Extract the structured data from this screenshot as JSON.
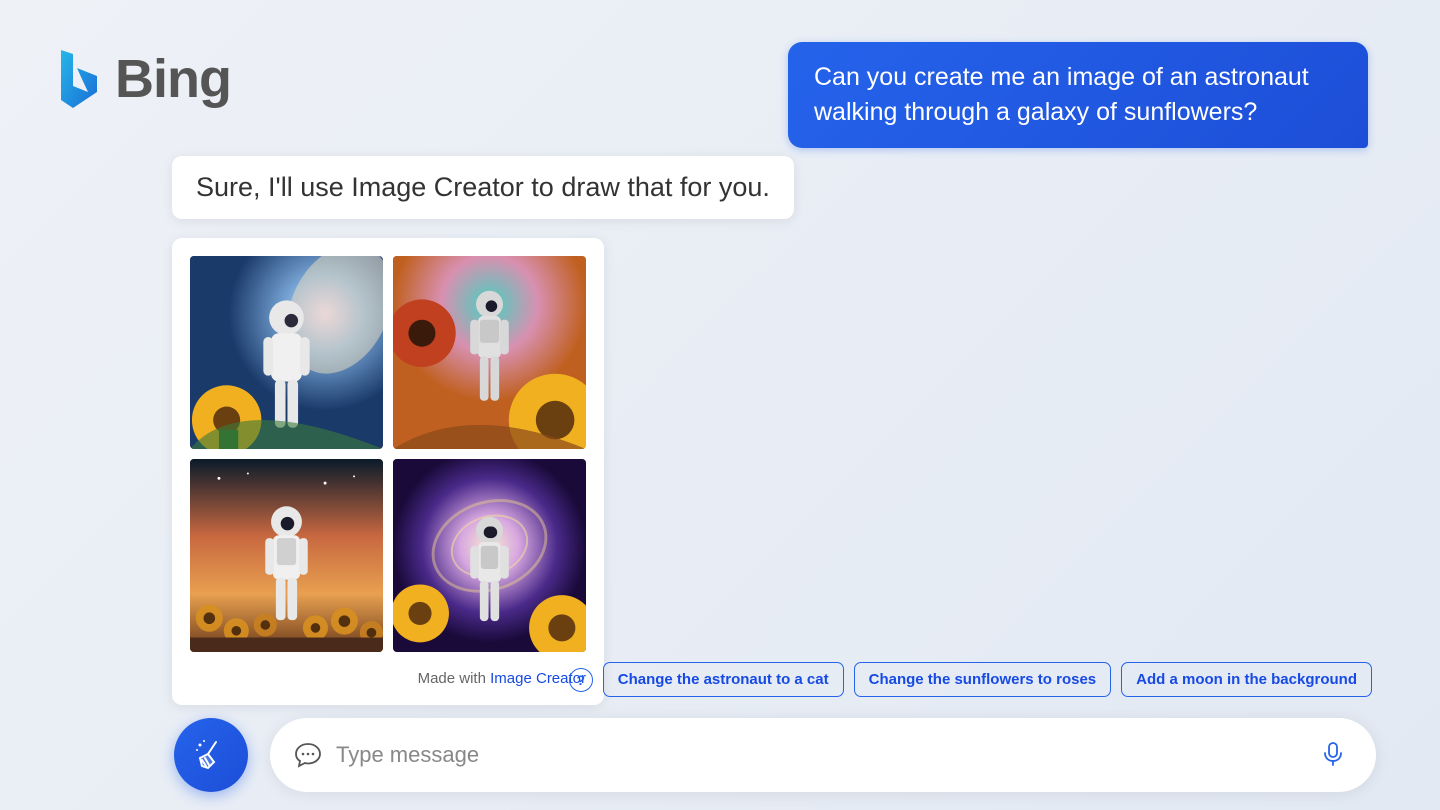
{
  "brand": {
    "name": "Bing"
  },
  "chat": {
    "user_message": "Can you create me an image of an astronaut walking through a galaxy of sunflowers?",
    "assistant_message": "Sure, I'll use Image Creator to draw that for you.",
    "attribution_prefix": "Made with ",
    "attribution_link": "Image Creator"
  },
  "suggestions": [
    "Change the astronaut to a cat",
    "Change the sunflowers to roses",
    "Add a moon in the background"
  ],
  "help_label": "?",
  "input": {
    "placeholder": "Type message"
  },
  "colors": {
    "primary": "#2563eb",
    "link": "#174ae4"
  }
}
